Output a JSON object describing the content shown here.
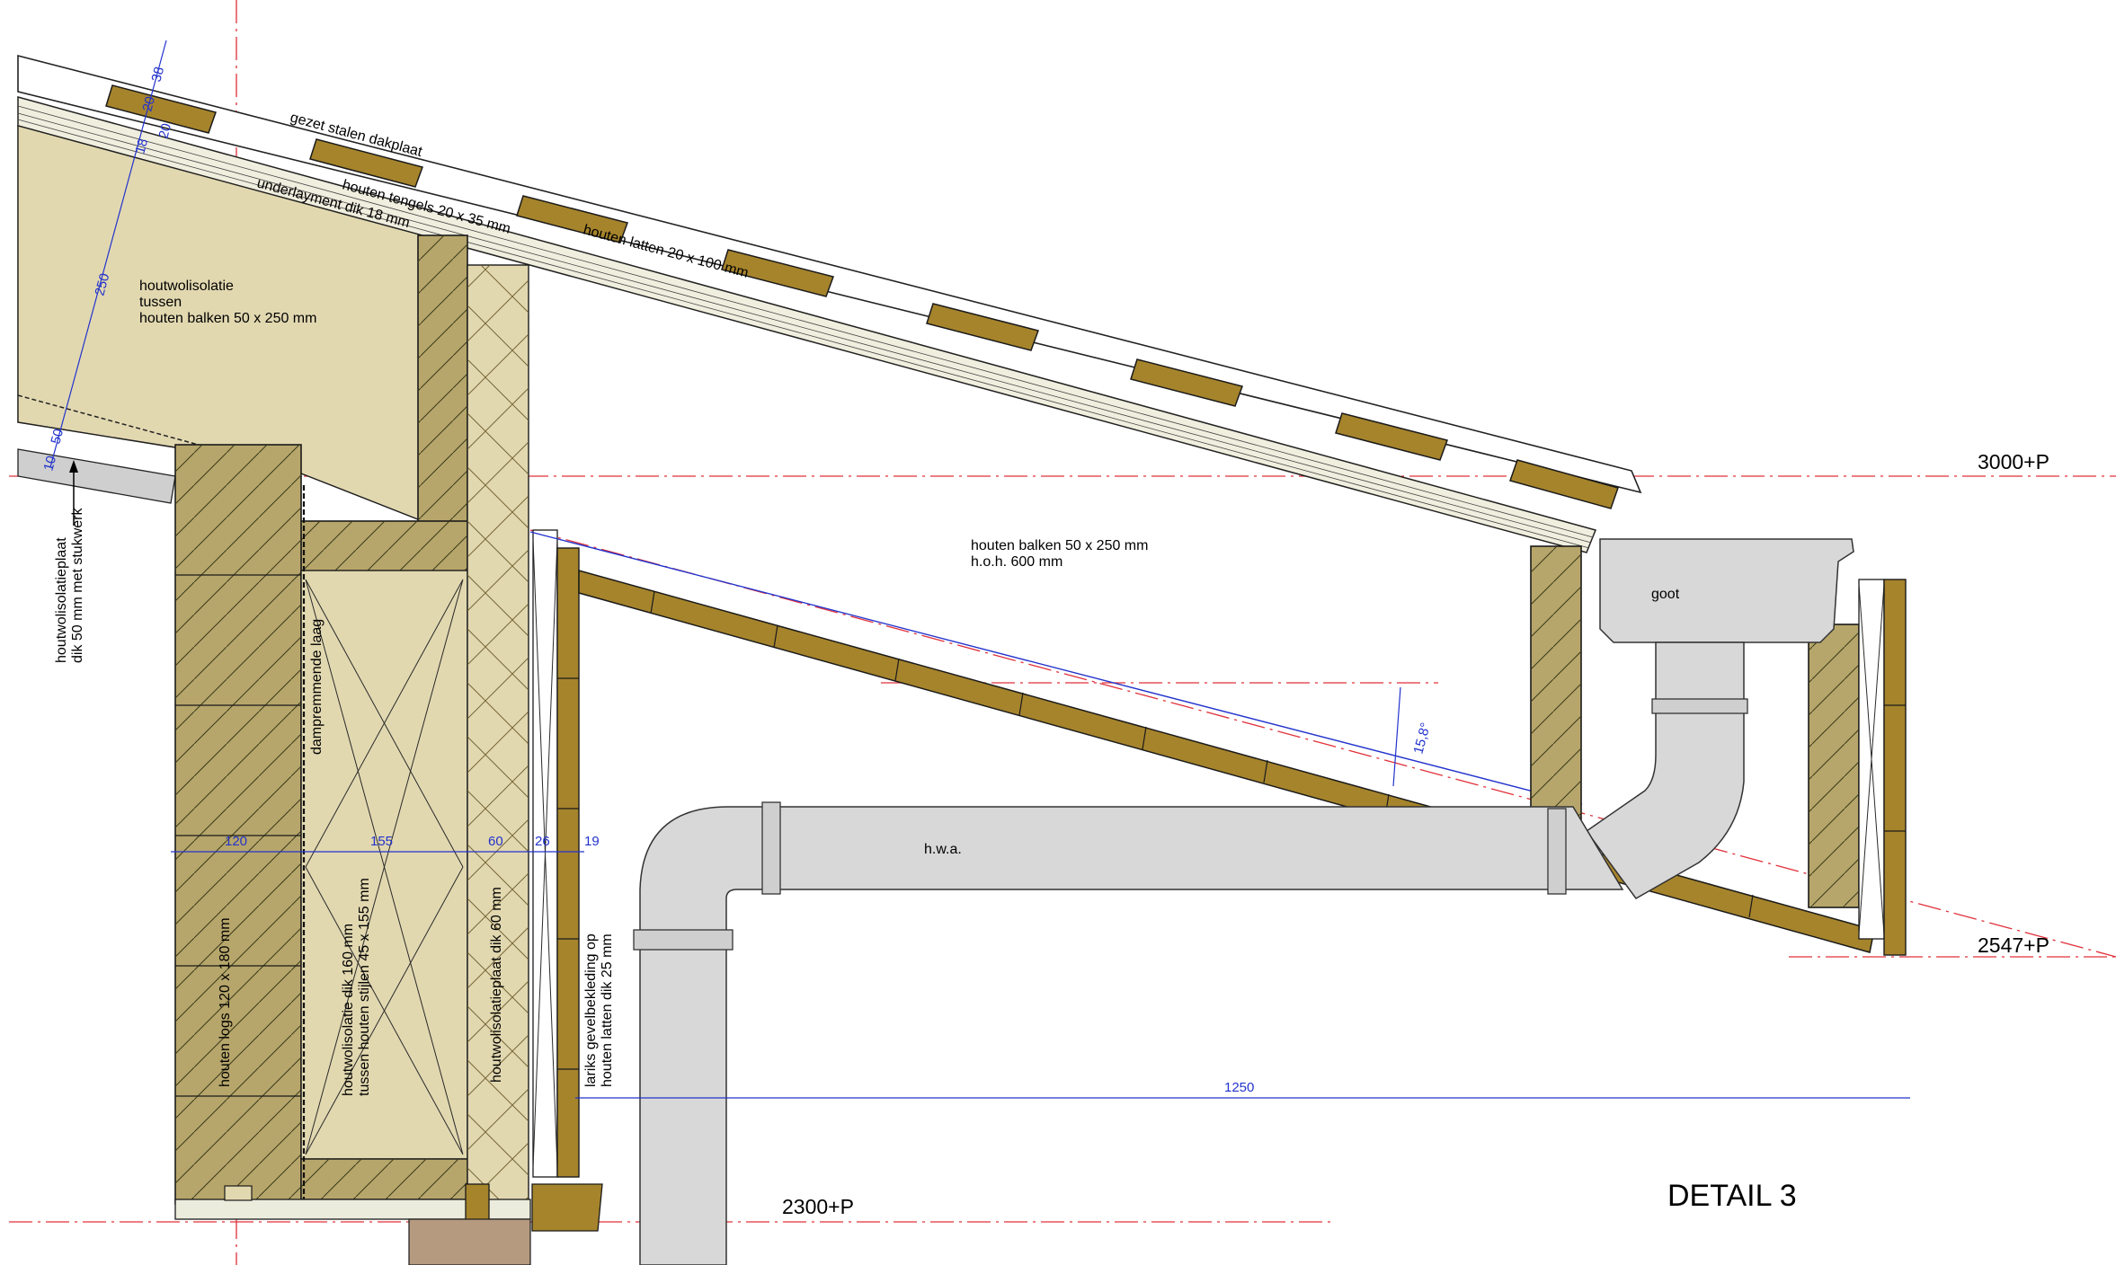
{
  "title": "DETAIL 3",
  "levels": {
    "top": "3000+P",
    "eave": "2547+P",
    "floor": "2300+P"
  },
  "labels": {
    "roof_plate": "gezet stalen dakplaat",
    "counter_battens": "houten tengels 20 x 35 mm",
    "battens": "houten latten 20 x 100 mm",
    "underlayment": "underlayment dik 18 mm",
    "insulation_line1": "houtwolisolatie",
    "insulation_line2": "tussen",
    "insulation_line3": "houten balken 50 x 250 mm",
    "beams_line1": "houten balken 50 x 250 mm",
    "beams_line2": "h.o.h. 600 mm",
    "gutter": "goot",
    "downpipe": "h.w.a.",
    "vapor_barrier": "dampremmende laag",
    "ceiling_board_line1": "houtwolisolatieplaat",
    "ceiling_board_line2": "dik 50 mm met stukwerk",
    "logs": "houten logs 120 x 180 mm",
    "wall_insulation_line1": "houtwolisolatie dik 160 mm",
    "wall_insulation_line2": "tussen houten stijlen 45 x 155 mm",
    "wall_board": "houtwolisolatieplaat dik 60 mm",
    "cladding_line1": "lariks gevelbekleding op",
    "cladding_line2": "houten latten dik 25 mm"
  },
  "dimensions": {
    "roof_20a": "20",
    "roof_38": "38",
    "roof_20b": "20",
    "roof_18": "18",
    "roof_250": "250",
    "roof_50": "50",
    "roof_10": "10",
    "angle": "15,8°",
    "wall_120": "120",
    "wall_155": "155",
    "wall_60": "60",
    "wall_26": "26",
    "wall_19": "19",
    "overhang": "1250"
  }
}
